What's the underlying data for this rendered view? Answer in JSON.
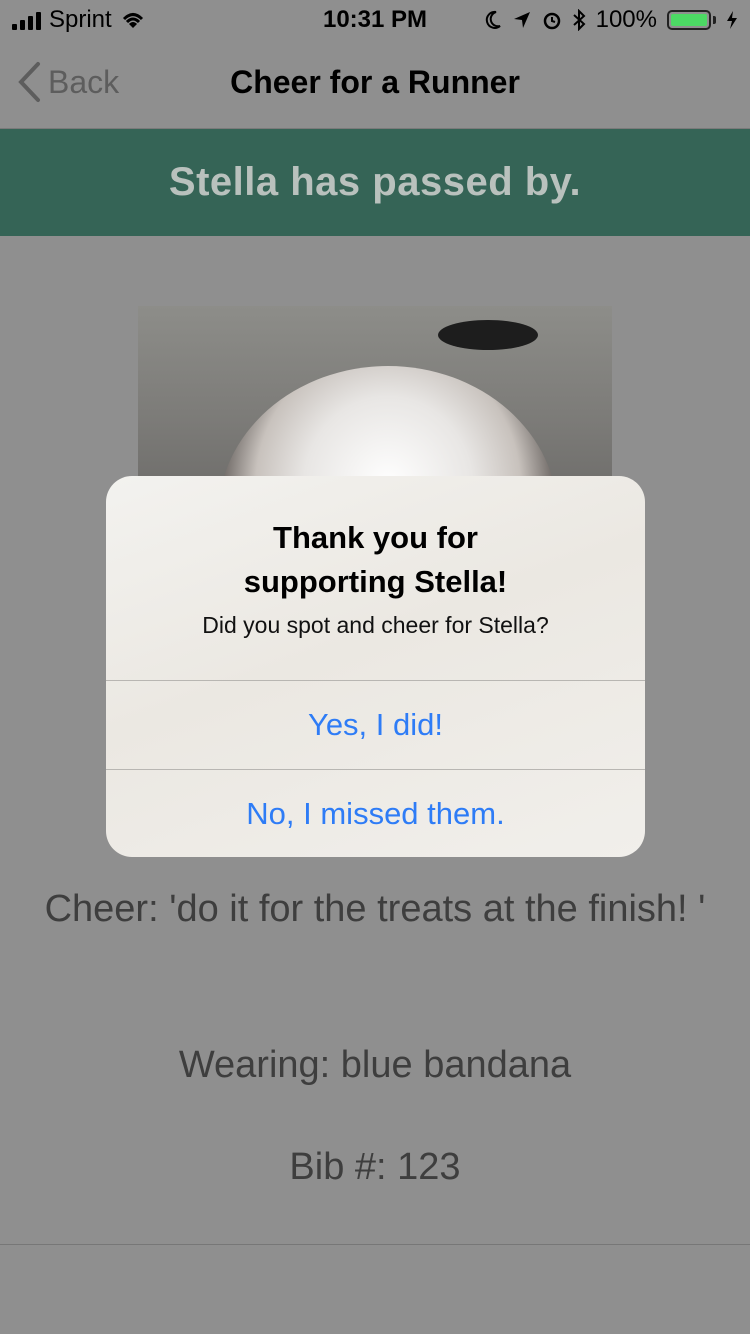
{
  "status_bar": {
    "carrier": "Sprint",
    "time": "10:31 PM",
    "battery_percent": "100%",
    "battery_level": 1.0
  },
  "nav": {
    "back_label": "Back",
    "title": "Cheer for a Runner"
  },
  "banner": {
    "text": "Stella has passed by."
  },
  "details": {
    "cheer": "Cheer: 'do it for the treats at the finish! '",
    "wearing": "Wearing: blue  bandana",
    "bib": "Bib #: 123"
  },
  "alert": {
    "title": "Thank you for supporting Stella!",
    "message": "Did you spot and cheer for Stella?",
    "buttons": [
      {
        "label": "Yes, I did!"
      },
      {
        "label": "No, I missed them."
      }
    ]
  },
  "colors": {
    "banner_bg": "#356456",
    "alert_button_text": "#2e7cf6",
    "dimmed_background": "#8f8f8f"
  }
}
